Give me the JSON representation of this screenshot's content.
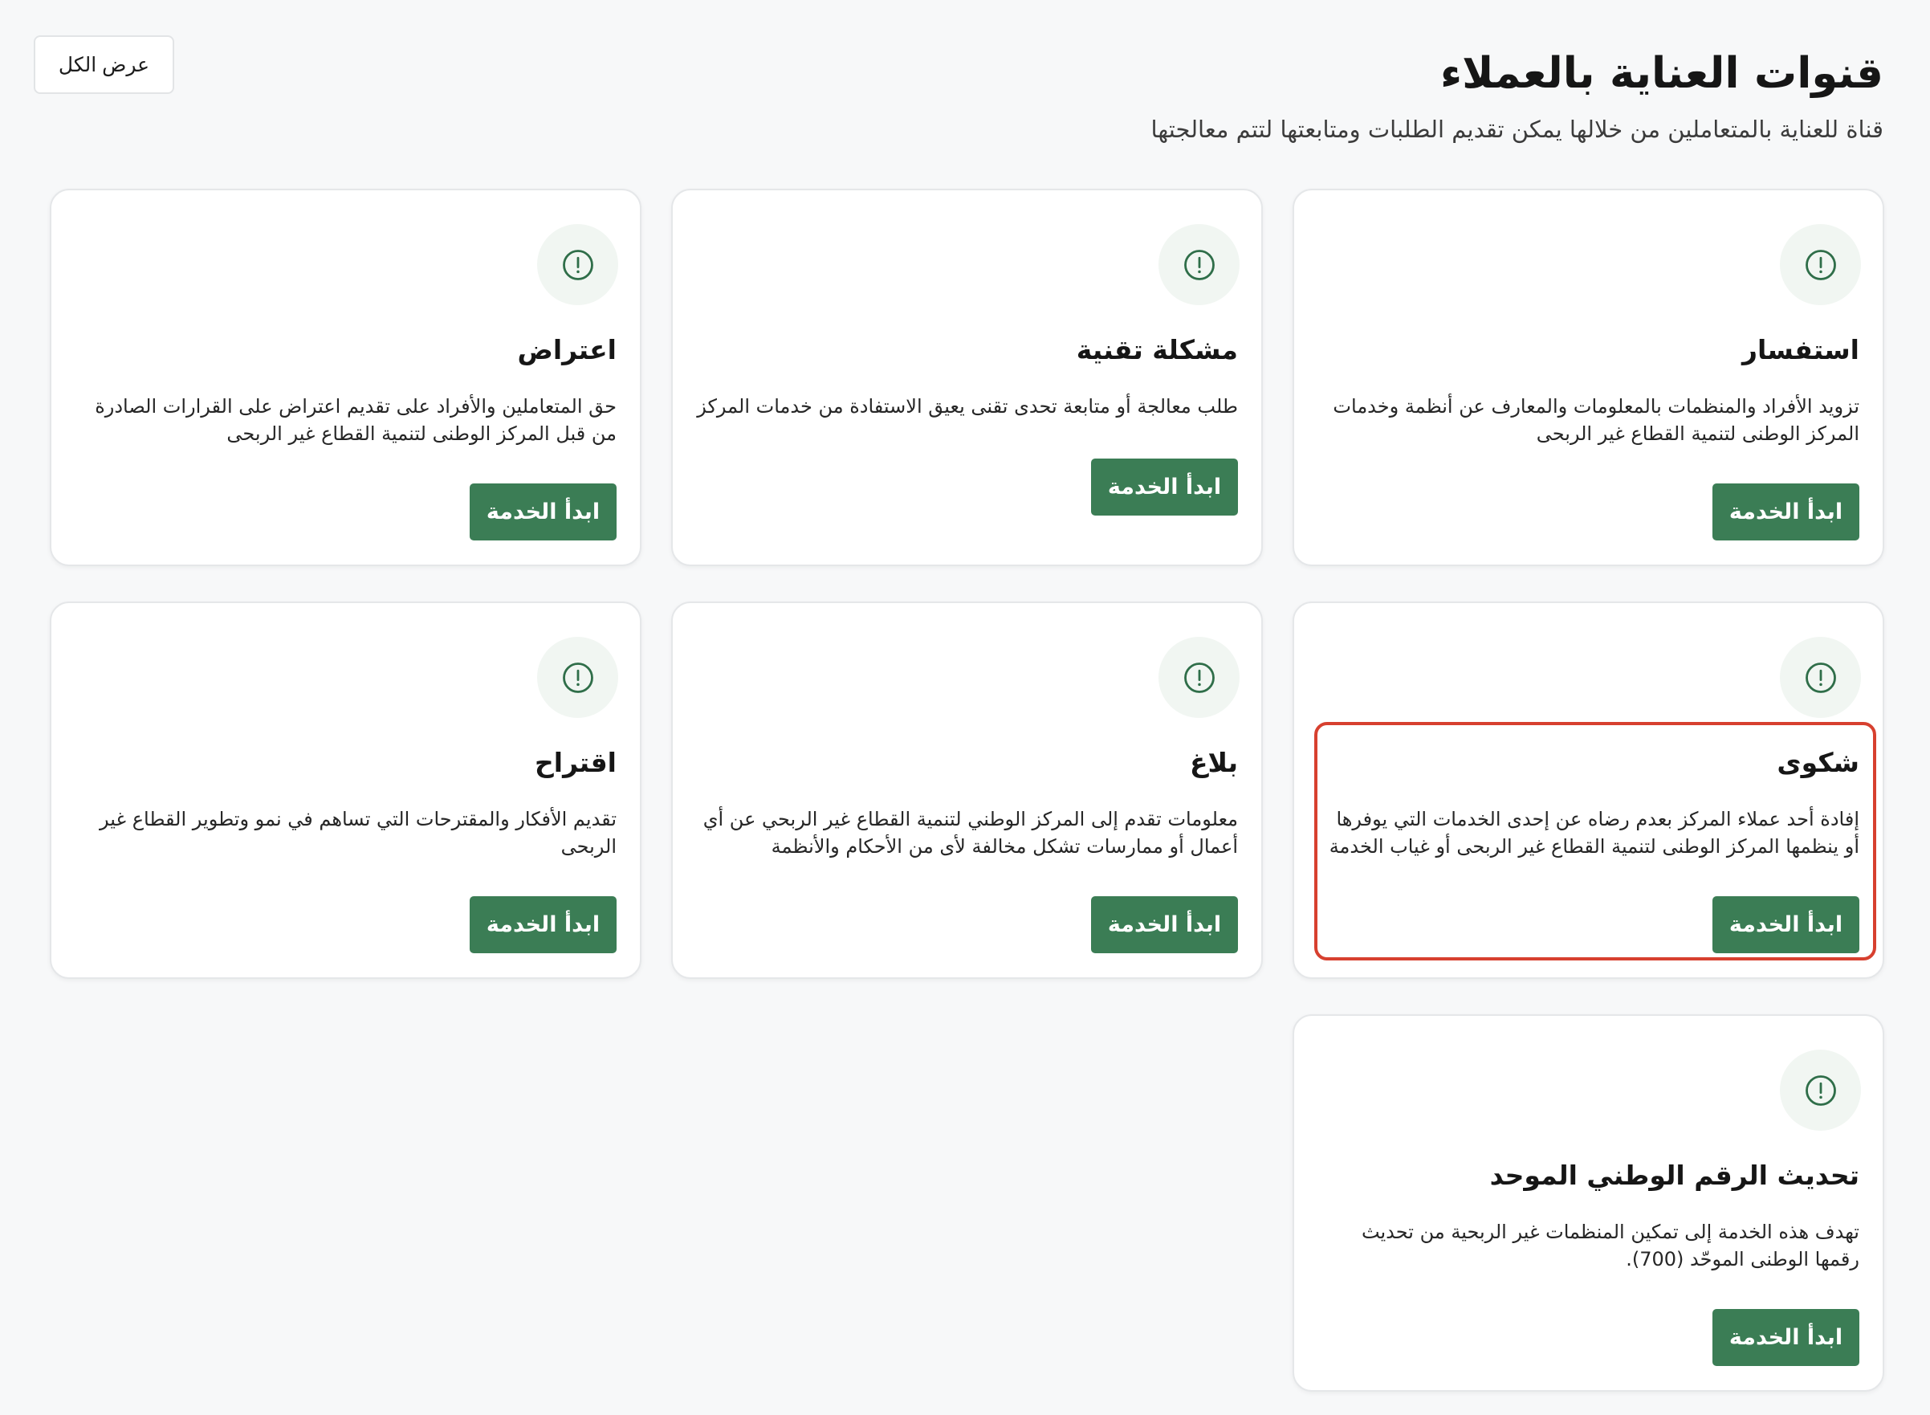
{
  "header": {
    "title": "قنوات العناية بالعملاء",
    "subtitle": "قناة للعناية بالمتعاملين من خلالها يمكن تقديم الطلبات ومتابعتها لتتم معالجتها",
    "view_all": "عرض الكل"
  },
  "cards": [
    {
      "title": "استفسار",
      "description": "تزويد الأفراد والمنظمات بالمعلومات والمعارف عن أنظمة وخدمات المركز الوطنى لتنمية القطاع غير الربحى",
      "button": "ابدأ الخدمة",
      "icon": "info-icon"
    },
    {
      "title": "مشكلة تقنية",
      "description": "طلب معالجة أو متابعة تحدى تقنى يعيق الاستفادة من خدمات المركز",
      "button": "ابدأ الخدمة",
      "icon": "info-icon"
    },
    {
      "title": "اعتراض",
      "description": "حق المتعاملين والأفراد على تقديم اعتراض على القرارات الصادرة من قبل المركز الوطنى لتنمية القطاع غير الربحى",
      "button": "ابدأ الخدمة",
      "icon": "info-icon"
    },
    {
      "title": "شكوى",
      "description": "إفادة أحد عملاء المركز بعدم رضاه عن إحدى الخدمات التي يوفرها أو ينظمها المركز الوطنى لتنمية القطاع غير الربحى أو غياب الخدمة بص...",
      "button": "ابدأ الخدمة",
      "icon": "info-icon"
    },
    {
      "title": "بلاغ",
      "description": "معلومات تقدم إلى المركز الوطني لتنمية القطاع غير الربحي عن أي أعمال أو ممارسات تشكل مخالفة لأى من الأحكام والأنظمة واللوائح...",
      "button": "ابدأ الخدمة",
      "icon": "info-icon"
    },
    {
      "title": "اقتراح",
      "description": "تقديم الأفكار والمقترحات التي تساهم في نمو وتطوير القطاع غير الربحى",
      "button": "ابدأ الخدمة",
      "icon": "info-icon"
    },
    {
      "title": "تحديث الرقم الوطني الموحد",
      "description": "تهدف هذه الخدمة إلى تمكين المنظمات غير الربحية من تحديث رقمها الوطنى الموحّد (700).",
      "button": "ابدأ الخدمة",
      "icon": "info-icon"
    }
  ],
  "colors": {
    "accent_green": "#3b7d55",
    "icon_green": "#2f6e49",
    "icon_background": "#f1f6f2",
    "highlight_red": "#d7402f",
    "page_background": "#f7f8f9"
  }
}
